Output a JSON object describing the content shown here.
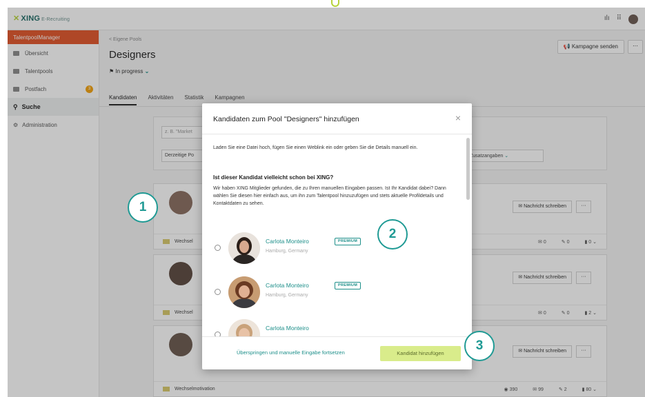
{
  "app": {
    "logo_brand": "XING",
    "logo_product": "E-Recruiting",
    "top_icons": [
      "chart-icon",
      "apps-grid-icon",
      "user-avatar"
    ]
  },
  "sidebar": {
    "title": "TalentpoolManager",
    "items": [
      {
        "label": "Übersicht",
        "icon": "dashboard-icon"
      },
      {
        "label": "Talentpools",
        "icon": "pool-icon"
      },
      {
        "label": "Postfach",
        "icon": "mail-icon",
        "badge": "3"
      },
      {
        "label": "Suche",
        "icon": "search-icon",
        "active": true
      },
      {
        "label": "Administration",
        "icon": "gear-icon"
      }
    ]
  },
  "main": {
    "breadcrumb": "< Eigene Pools",
    "title": "Designers",
    "status": "In progress",
    "campaign_button": "Kampagne senden",
    "more_button": "···",
    "tabs": [
      "Kandidaten",
      "Aktivitäten",
      "Statistik",
      "Kampagnen"
    ],
    "search_placeholder": "z. B. \"Market",
    "filter_current_position": "Derzeitige Po",
    "filter_more": "Zusatzangaben",
    "cards": [
      {
        "message_button": "Nachricht schreiben",
        "footer_label": "Wechsel",
        "stats": [
          "0",
          "0",
          "0"
        ]
      },
      {
        "message_button": "Nachricht schreiben",
        "footer_label": "Wechsel",
        "stats": [
          "0",
          "0",
          "2"
        ]
      },
      {
        "message_button": "Nachricht schreiben",
        "footer_label": "Wechselmotivation",
        "stats": [
          "390",
          "99",
          "2",
          "80"
        ]
      }
    ]
  },
  "modal": {
    "title": "Kandidaten zum Pool \"Designers\" hinzufügen",
    "close": "×",
    "intro": "Laden Sie eine Datei hoch, fügen Sie einen Weblink ein oder geben Sie die Details manuell ein.",
    "question": "Ist dieser Kandidat vielleicht schon bei XING?",
    "description": "Wir haben XING Mitglieder gefunden, die zu Ihren manuellen Eingaben passen. Ist Ihr Kandidat dabei? Dann wählen Sie diesen hier einfach aus, um ihn zum Talentpool hinzuzufügen und stets aktuelle Profildetails und Kontaktdaten zu sehen.",
    "candidates": [
      {
        "name": "Carlota Monteiro",
        "location": "Hamburg, Germany",
        "badge": "PREMIUM"
      },
      {
        "name": "Carlota Monteiro",
        "location": "Hamburg, Germany",
        "badge": "PREMIUM"
      },
      {
        "name": "Carlota Monteiro",
        "location": "",
        "badge": ""
      }
    ],
    "skip_link": "Überspringen und manuelle Eingabe fortsetzen",
    "add_button": "Kandidat hinzufügen"
  },
  "callouts": [
    "1",
    "2",
    "3"
  ],
  "colors": {
    "teal": "#1d8f8a",
    "lime": "#d9ec8b",
    "orange": "#e2562a"
  }
}
